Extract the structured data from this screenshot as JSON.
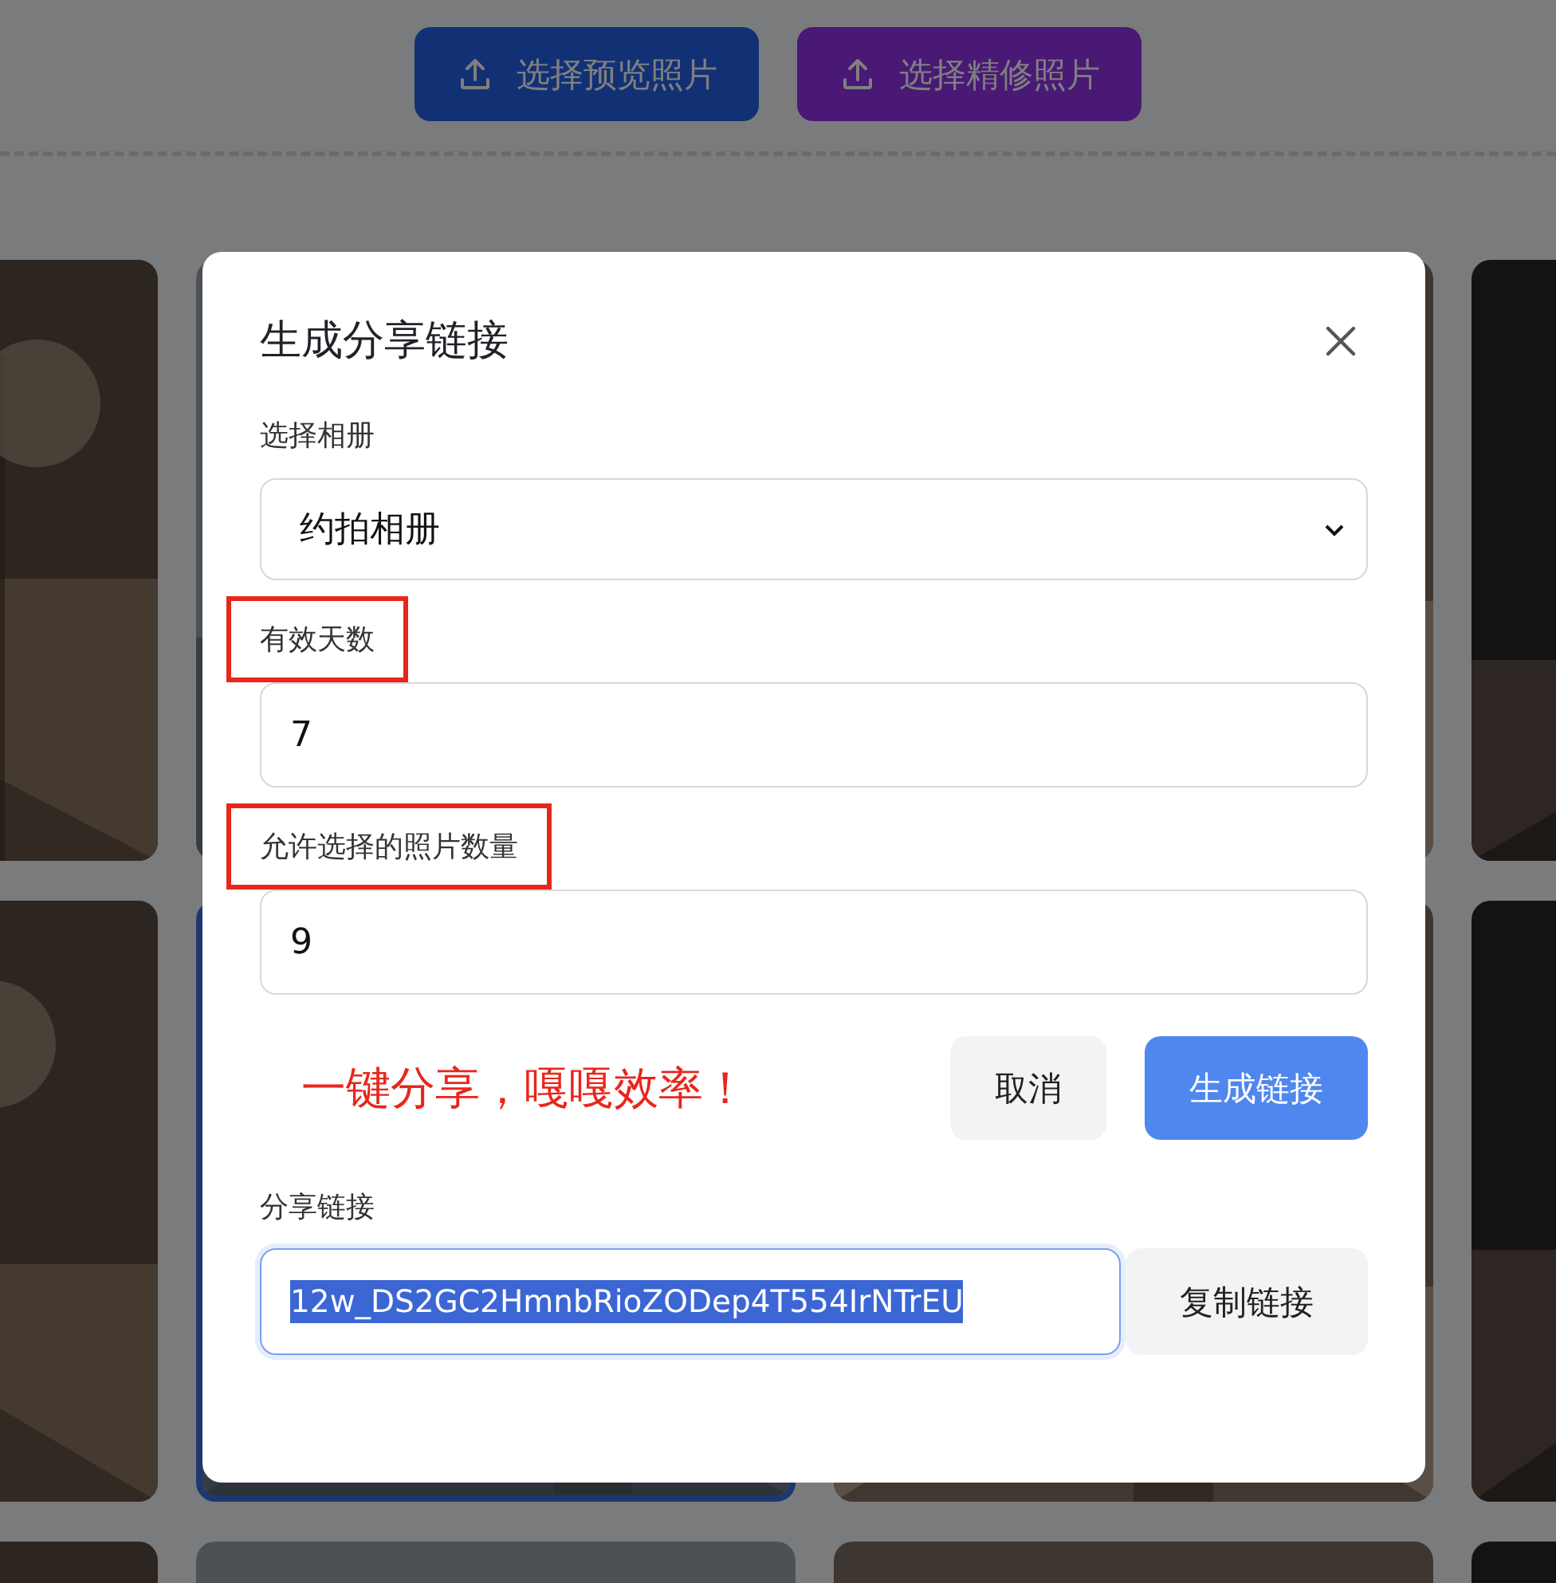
{
  "page": {
    "upload_buttons": [
      {
        "label": "选择预览照片",
        "kind": "preview"
      },
      {
        "label": "选择精修照片",
        "kind": "retouched"
      }
    ],
    "photos": [
      {
        "kind": "picture",
        "selected": false
      },
      {
        "kind": "picture",
        "selected": false
      },
      {
        "kind": "picture",
        "selected": false
      },
      {
        "kind": "picture",
        "selected": false
      },
      {
        "kind": "picture",
        "selected": false
      },
      {
        "kind": "picture",
        "selected": true
      },
      {
        "kind": "picture",
        "selected": false
      },
      {
        "kind": "picture",
        "selected": false
      },
      {
        "kind": "picture",
        "selected": false
      },
      {
        "kind": "picture",
        "selected": false
      },
      {
        "kind": "picture",
        "selected": false
      },
      {
        "kind": "picture",
        "selected": false
      }
    ]
  },
  "dialog": {
    "title": "生成分享链接",
    "fields": [
      {
        "kind": "select",
        "label": "选择相册",
        "value": "约拍相册",
        "highlighted": false
      },
      {
        "kind": "input",
        "label": "有效天数",
        "value": "7",
        "highlighted": true
      },
      {
        "kind": "input",
        "label": "允许选择的照片数量",
        "value": "9",
        "highlighted": true
      }
    ],
    "note": "一键分享，嘎嘎效率！",
    "buttons": [
      {
        "label": "取消",
        "primary": false
      },
      {
        "label": "生成链接",
        "primary": true
      }
    ],
    "share": {
      "label": "分享链接",
      "value": "12w_DS2GC2HmnbRioZODep4T554IrNTrEU",
      "text_selected": true,
      "copy_label": "复制链接"
    }
  }
}
